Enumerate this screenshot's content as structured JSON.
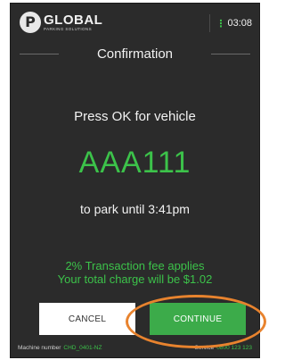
{
  "header": {
    "brand_name": "GLOBAL",
    "brand_sub": "PARKING SOLUTIONS",
    "clock_icon": "vertical-dots-icon",
    "time": "03:08"
  },
  "title": "Confirmation",
  "prompt": "Press OK for vehicle",
  "plate": "AAA111",
  "until": "to park until 3:41pm",
  "fee": {
    "line1": "2% Transaction fee applies",
    "line2": "Your total charge will be $1.02"
  },
  "buttons": {
    "cancel": "CANCEL",
    "continue": "CONTINUE"
  },
  "footer": {
    "machine_label": "Machine number",
    "machine_value": "CHD_0401-NZ",
    "service_label": "Service",
    "service_value": "0800 123 123"
  },
  "colors": {
    "accent": "#3cc24a",
    "background": "#2b2b2b",
    "highlight": "#e8832e"
  }
}
